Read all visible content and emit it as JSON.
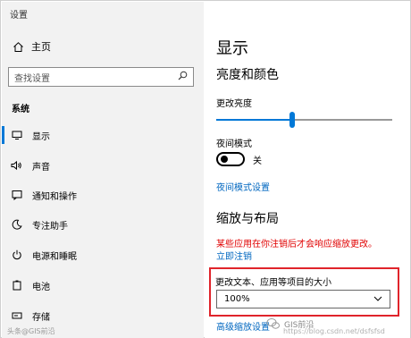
{
  "window": {
    "title": "设置"
  },
  "sidebar": {
    "home_label": "主页",
    "search_placeholder": "查找设置",
    "section_label": "系统",
    "items": [
      {
        "label": "显示",
        "icon": "monitor-icon"
      },
      {
        "label": "声音",
        "icon": "speaker-icon"
      },
      {
        "label": "通知和操作",
        "icon": "notification-icon"
      },
      {
        "label": "专注助手",
        "icon": "moon-icon"
      },
      {
        "label": "电源和睡眠",
        "icon": "power-icon"
      },
      {
        "label": "电池",
        "icon": "battery-icon"
      },
      {
        "label": "存储",
        "icon": "storage-icon"
      }
    ]
  },
  "main": {
    "page_title": "显示",
    "brightness_heading": "亮度和颜色",
    "brightness_label": "更改亮度",
    "brightness_value": 0.43,
    "night_light_label": "夜间模式",
    "night_light_state": "关",
    "night_light_settings_link": "夜间模式设置",
    "scale_heading": "缩放与布局",
    "warning_text": "某些应用在你注销后才会响应缩放更改。",
    "sign_out_link": "立即注销",
    "scale_label": "更改文本、应用等项目的大小",
    "scale_value": "100%",
    "advanced_scaling_link": "高级缩放设置"
  },
  "watermark": {
    "left": "头条@GIS前沿",
    "right_brand": "GIS前沿",
    "url": "https://blog.csdn.net/dsfsfsd"
  },
  "colors": {
    "accent": "#0078d7",
    "link": "#0067c0",
    "warning": "#e00000",
    "highlight": "#e0242b",
    "sidebar_bg": "#f2f2f2"
  }
}
